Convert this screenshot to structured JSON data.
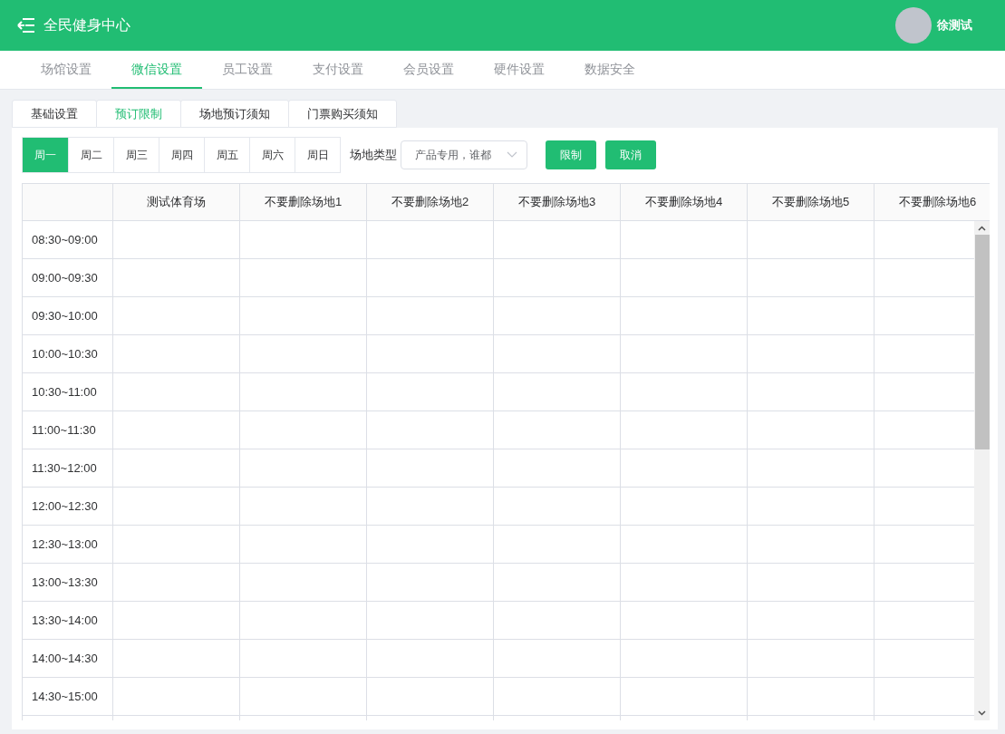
{
  "header": {
    "title": "全民健身中心",
    "user": "徐测试"
  },
  "nav_tabs": [
    {
      "label": "场馆设置",
      "selected": false
    },
    {
      "label": "微信设置",
      "selected": true
    },
    {
      "label": "员工设置",
      "selected": false
    },
    {
      "label": "支付设置",
      "selected": false
    },
    {
      "label": "会员设置",
      "selected": false
    },
    {
      "label": "硬件设置",
      "selected": false
    },
    {
      "label": "数据安全",
      "selected": false
    }
  ],
  "sub_tabs": [
    {
      "label": "基础设置",
      "selected": false
    },
    {
      "label": "预订限制",
      "selected": true
    },
    {
      "label": "场地预订须知",
      "selected": false
    },
    {
      "label": "门票购买须知",
      "selected": false
    }
  ],
  "weekdays": [
    {
      "label": "周一",
      "selected": true
    },
    {
      "label": "周二",
      "selected": false
    },
    {
      "label": "周三",
      "selected": false
    },
    {
      "label": "周四",
      "selected": false
    },
    {
      "label": "周五",
      "selected": false
    },
    {
      "label": "周六",
      "selected": false
    },
    {
      "label": "周日",
      "selected": false
    }
  ],
  "venue_type": {
    "label": "场地类型",
    "value": "产品专用，谁都"
  },
  "buttons": [
    "限制",
    "取消"
  ],
  "table": {
    "columns": [
      "测试体育场",
      "不要删除场地1",
      "不要删除场地2",
      "不要删除场地3",
      "不要删除场地4",
      "不要删除场地5",
      "不要删除场地6"
    ],
    "rows": [
      "08:30~09:00",
      "09:00~09:30",
      "09:30~10:00",
      "10:00~10:30",
      "10:30~11:00",
      "11:00~11:30",
      "11:30~12:00",
      "12:00~12:30",
      "12:30~13:00",
      "13:00~13:30",
      "13:30~14:00",
      "14:00~14:30",
      "14:30~15:00"
    ]
  }
}
